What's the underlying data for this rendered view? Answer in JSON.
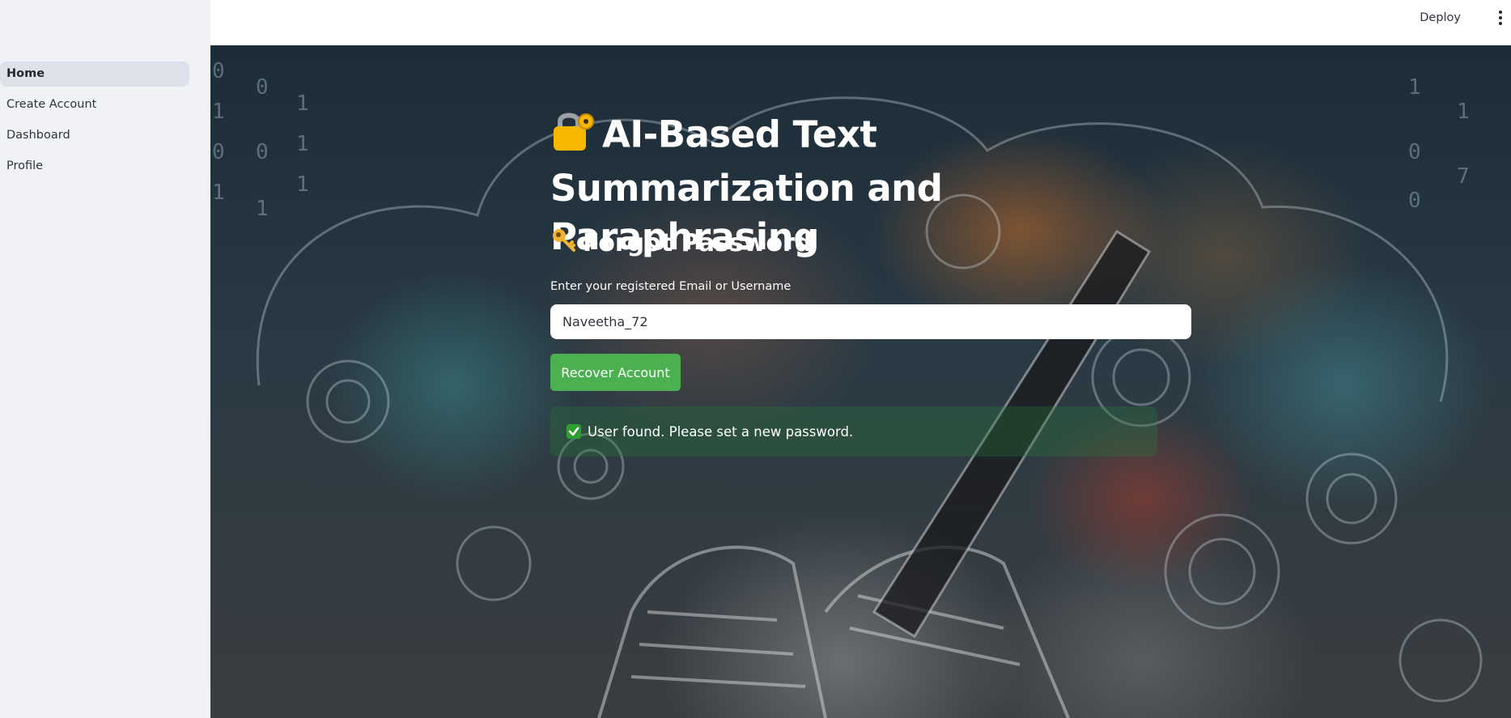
{
  "sidebar": {
    "items": [
      {
        "label": "Home",
        "active": true
      },
      {
        "label": "Create Account",
        "active": false
      },
      {
        "label": "Dashboard",
        "active": false
      },
      {
        "label": "Profile",
        "active": false
      }
    ]
  },
  "header": {
    "deploy_label": "Deploy",
    "menu_icon": "vertical-dots-icon"
  },
  "main": {
    "title": "AI-Based Text Summarization and Paraphrasing",
    "title_icon": "lock-with-key-icon",
    "subtitle": "Forgot Password",
    "subtitle_icon": "key-icon",
    "input_label": "Enter your registered Email or Username",
    "input_value": "Naveetha_72",
    "button_label": "Recover Account",
    "success_message": "User found. Please set a new password.",
    "success_icon": "check-mark-icon"
  },
  "colors": {
    "sidebar_bg": "#f0f2f6",
    "button_bg": "#4caf50",
    "success_bg": "#28783c",
    "text_light": "#ffffff"
  }
}
